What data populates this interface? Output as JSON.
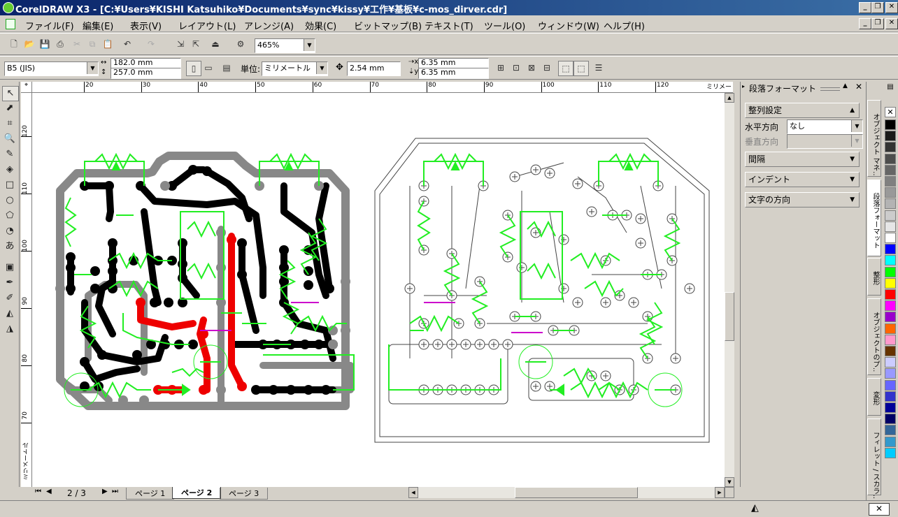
{
  "window": {
    "title": "CorelDRAW X3 - [C:¥Users¥KISHI Katsuhiko¥Documents¥sync¥kissy¥工作¥基板¥c-mos_dirver.cdr]"
  },
  "menu": [
    "ファイル(F)",
    "編集(E)",
    "表示(V)",
    "レイアウト(L)",
    "アレンジ(A)",
    "効果(C)",
    "ビットマップ(B)",
    "テキスト(T)",
    "ツール(O)",
    "ウィンドウ(W)",
    "ヘルプ(H)"
  ],
  "toolbar": {
    "zoom": "465%"
  },
  "property_bar": {
    "paper": "B5 (JIS)",
    "width": "182.0 mm",
    "height": "257.0 mm",
    "units_label": "単位:",
    "units": "ミリメートル",
    "nudge": "2.54 mm",
    "dup_x": "6.35 mm",
    "dup_y": "6.35 mm"
  },
  "ruler": {
    "unit": "ミリメートル",
    "top_ticks": [
      "20",
      "30",
      "40",
      "50",
      "60",
      "70",
      "80",
      "90",
      "100",
      "110",
      "120"
    ],
    "left_ticks": [
      "120",
      "110",
      "100",
      "90",
      "80",
      "70"
    ],
    "left_unit": "ミリメートル"
  },
  "page_nav": {
    "counter": "2 / 3",
    "tabs": [
      "ページ 1",
      "ページ 2",
      "ページ 3"
    ],
    "active": 1
  },
  "docker": {
    "title": "段落フォーマット",
    "section_align": "整列設定",
    "horizontal_label": "水平方向",
    "horizontal_value": "なし",
    "vertical_label": "垂直方向",
    "spacing": "間隔",
    "indent": "インデント",
    "text_direction": "文字の方向"
  },
  "side_tabs": [
    "オブジェクト マネ..",
    "段落フォーマット",
    "整形",
    "オブジェクトのプ..",
    "変形",
    "フィレット / スカラ.."
  ],
  "palette_colors": [
    "#000000",
    "#1a1a1a",
    "#333333",
    "#4d4d4d",
    "#666666",
    "#808080",
    "#999999",
    "#b3b3b3",
    "#cccccc",
    "#e6e6e6",
    "#ffffff",
    "#0000ff",
    "#00ffff",
    "#00ff00",
    "#ffff00",
    "#ff0000",
    "#ff00ff",
    "#9900cc",
    "#ff6600",
    "#ff99cc",
    "#663300",
    "#ccccff",
    "#9999ff",
    "#6666ff",
    "#3333cc",
    "#000099",
    "#000066",
    "#336699",
    "#3399cc",
    "#00ccff"
  ]
}
